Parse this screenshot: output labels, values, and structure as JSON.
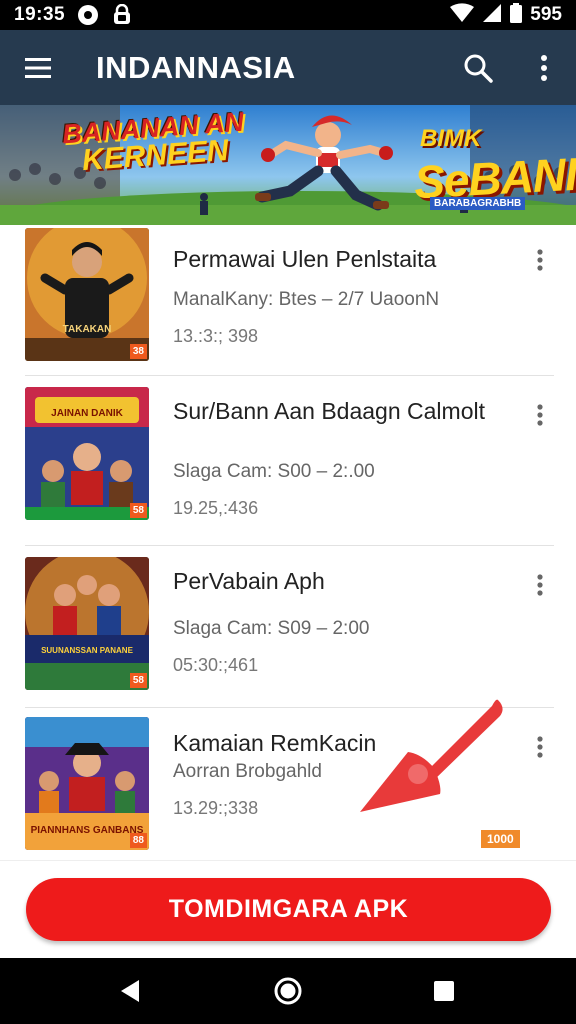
{
  "status_bar": {
    "time": "19:35",
    "battery_text": "595",
    "icons": [
      "notification-icon",
      "lock-icon",
      "wifi-icon",
      "signal-icon",
      "battery-icon"
    ]
  },
  "app_bar": {
    "title": "INDANNASIA",
    "icons": [
      "menu-icon",
      "search-icon",
      "more-vert-icon"
    ],
    "background": "#263a4f"
  },
  "banner": {
    "left_line1": "BANANAN AN",
    "left_line2": "KERNEEN",
    "right_line1": "BIMK",
    "right_line2": "SeBANI",
    "right_small": "BARABAGRABHB"
  },
  "items": [
    {
      "name": "Permawai Ulen Penlstaita",
      "sub": "ManalKany: Btes – 2/7 UaoonN",
      "meta": "13.:3:; 398",
      "badge": "38",
      "thumb_title": "TAKAKAN"
    },
    {
      "name": "Sur/Bann Aan Bdaagn Calmolt",
      "sub": "Slaga Cam: S00 – 2:.00",
      "meta": "19.25,:436",
      "badge": "58",
      "thumb_title": "JAINAN DANIK"
    },
    {
      "name": "PerVabain Aph",
      "sub": "Slaga Cam: S09 – 2:00",
      "meta": "05:30:;461",
      "badge": "58",
      "thumb_title": "SUUNANSSAN PANANE"
    },
    {
      "name": "Kamaian RemKacin",
      "sub": "Aorran Brobgahld",
      "meta": "13.29:;338",
      "badge": "88",
      "thumb_title": "PIANNHANS GANBANS"
    }
  ],
  "overlay_tag": "1000",
  "cta": {
    "label": "TOMDIMGARA APK",
    "color": "#ee1b1b"
  },
  "nav_bar": {
    "icons": [
      "back-icon",
      "home-icon",
      "recents-icon"
    ]
  }
}
